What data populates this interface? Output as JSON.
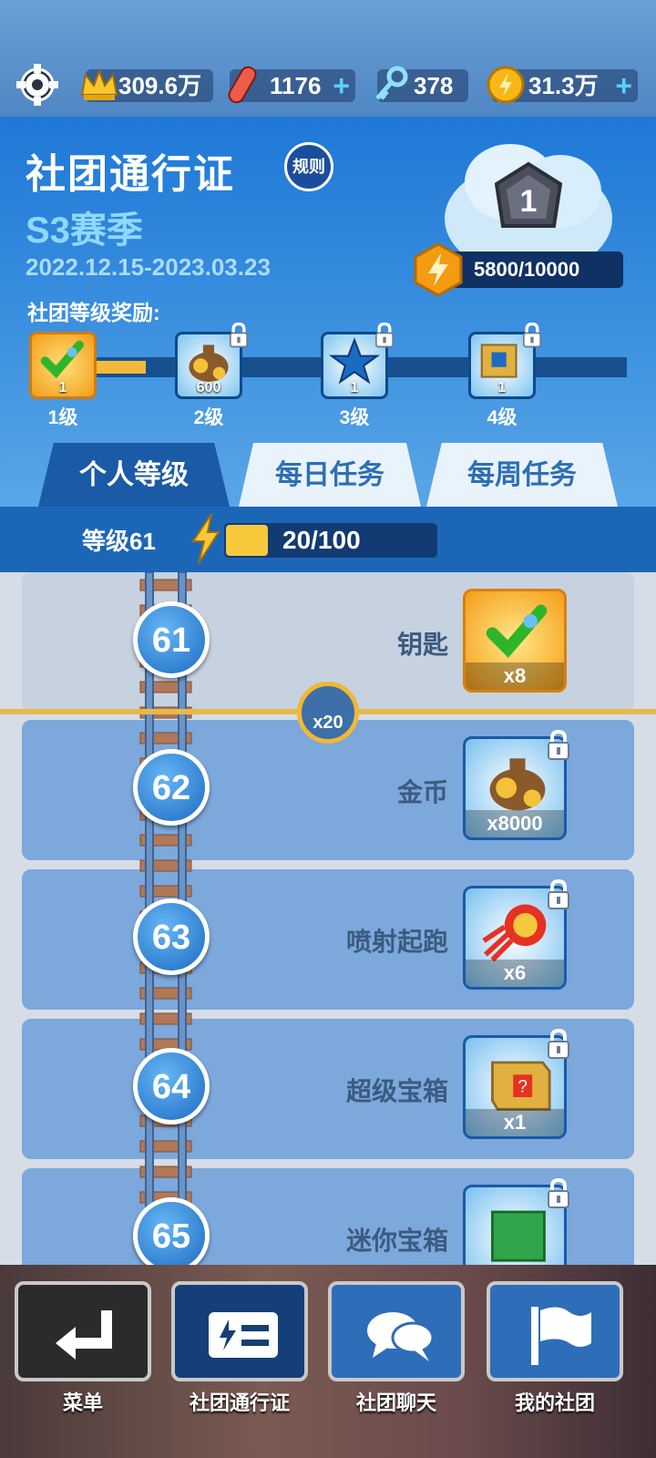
{
  "resources": {
    "crowns": "309.6万",
    "hoverboards": "1176",
    "keys": "378",
    "coins": "31.3万"
  },
  "header": {
    "title": "社团通行证",
    "rules_label": "规则",
    "season": "S3赛季",
    "dates": "2022.12.15-2023.03.23",
    "tier_number": "1",
    "xp_text": "5800/10000",
    "xp_fraction": 0.58,
    "rewards_label": "社团等级奖励:"
  },
  "club_rewards": [
    {
      "level": "1级",
      "count": "1",
      "icon": "key-check-icon",
      "locked": false
    },
    {
      "level": "2级",
      "count": "600",
      "icon": "coin-bag-icon",
      "locked": true
    },
    {
      "level": "3级",
      "count": "1",
      "icon": "star-icon",
      "locked": true
    },
    {
      "level": "4级",
      "count": "1",
      "icon": "mystery-box-icon",
      "locked": true
    }
  ],
  "tabs": [
    "个人等级",
    "每日任务",
    "每周任务"
  ],
  "personal_level": {
    "label": "等级61",
    "progress_text": "20/100",
    "progress_fraction": 0.2
  },
  "level_rows": [
    {
      "level": "61",
      "name": "钥匙",
      "qty": "x8",
      "icon": "key-check-icon",
      "locked": false
    },
    {
      "level": "62",
      "name": "金币",
      "qty": "x8000",
      "icon": "coin-bag-icon",
      "locked": true
    },
    {
      "level": "63",
      "name": "喷射起跑",
      "qty": "x6",
      "icon": "jet-start-icon",
      "locked": true
    },
    {
      "level": "64",
      "name": "超级宝箱",
      "qty": "x1",
      "icon": "super-box-icon",
      "locked": true
    },
    {
      "level": "65",
      "name": "迷你宝箱",
      "qty": "",
      "icon": "mini-box-icon",
      "locked": true
    }
  ],
  "milestone_badge": "x20",
  "nav": [
    "菜单",
    "社团通行证",
    "社团聊天",
    "我的社团"
  ]
}
